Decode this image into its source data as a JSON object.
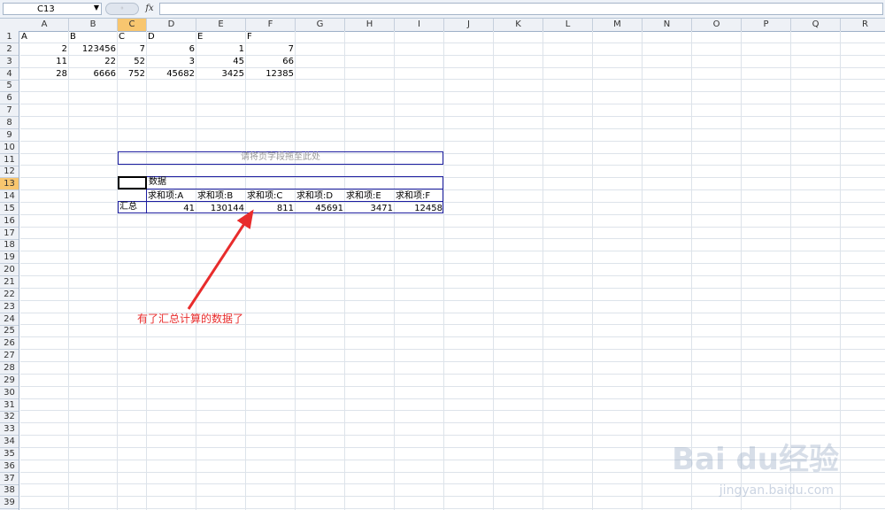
{
  "formula_bar": {
    "name_box": "C13",
    "formula": ""
  },
  "columns": [
    "A",
    "B",
    "C",
    "D",
    "E",
    "F",
    "G",
    "H",
    "I",
    "J",
    "K",
    "L",
    "M",
    "N",
    "O",
    "P",
    "Q",
    "R"
  ],
  "selected_column": "C",
  "rows": [
    "1",
    "2",
    "3",
    "4",
    "5",
    "6",
    "7",
    "8",
    "9",
    "10",
    "11",
    "12",
    "13",
    "14",
    "15",
    "16",
    "17",
    "18",
    "19",
    "20",
    "21",
    "22",
    "23",
    "24",
    "25",
    "26",
    "27",
    "28",
    "29",
    "30",
    "31",
    "32",
    "33",
    "34",
    "35",
    "36",
    "37",
    "38",
    "39"
  ],
  "selected_row": "13",
  "header_row": [
    "A",
    "B",
    "C",
    "D",
    "E",
    "F"
  ],
  "data_rows": [
    [
      "2",
      "123456",
      "7",
      "6",
      "1",
      "7"
    ],
    [
      "11",
      "22",
      "52",
      "3",
      "45",
      "66"
    ],
    [
      "28",
      "6666",
      "752",
      "45682",
      "3425",
      "12385"
    ]
  ],
  "pivot": {
    "page_drop_text": "请将页字段拖至此处",
    "data_label": "数据",
    "sum_headers": [
      "求和项:A",
      "求和项:B",
      "求和项:C",
      "求和项:D",
      "求和项:E",
      "求和项:F"
    ],
    "total_label": "汇总",
    "totals": [
      "41",
      "130144",
      "811",
      "45691",
      "3471",
      "12458"
    ]
  },
  "annotation": "有了汇总计算的数据了",
  "watermark": {
    "brand": "Bai du经验",
    "url": "jingyan.baidu.com"
  },
  "colors": {
    "pivot_border": "#1e1ea0",
    "annotation": "#e82c2c",
    "selected_header": "#f8c66f"
  }
}
